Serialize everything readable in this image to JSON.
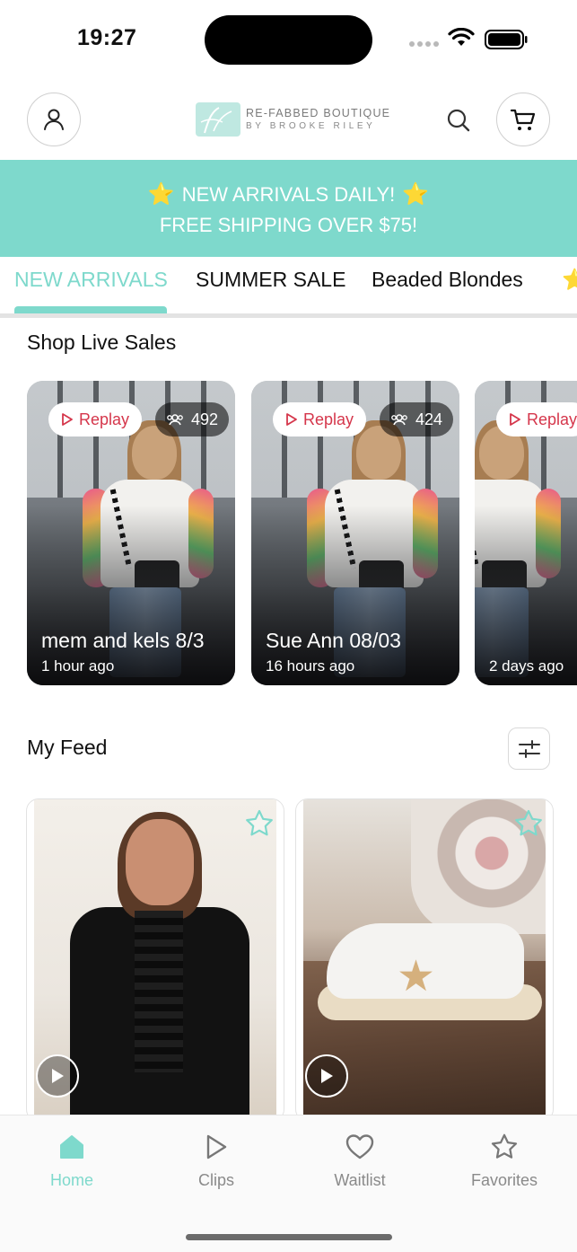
{
  "status_bar": {
    "time": "19:27"
  },
  "header": {
    "logo_line1": "RE-FABBED BOUTIQUE",
    "logo_line2": "BY BROOKE RILEY"
  },
  "banner": {
    "line1": "NEW ARRIVALS DAILY!",
    "line2": "FREE SHIPPING OVER $75!",
    "star_glyph": "⭐"
  },
  "tabs": [
    {
      "label": "NEW ARRIVALS",
      "active": true
    },
    {
      "label": "SUMMER SALE",
      "active": false
    },
    {
      "label": "Beaded Blondes",
      "active": false
    },
    {
      "label": "⭐",
      "active": false
    }
  ],
  "live_sales": {
    "title": "Shop Live Sales",
    "cards": [
      {
        "replay_label": "Replay",
        "viewers": "492",
        "name": "mem and kels 8/3",
        "time": "1 hour ago"
      },
      {
        "replay_label": "Replay",
        "viewers": "424",
        "name": "Sue Ann 08/03",
        "time": "16 hours ago"
      },
      {
        "replay_label": "Replay",
        "viewers": "",
        "name": "",
        "time": "2 days ago"
      }
    ]
  },
  "feed": {
    "title": "My Feed",
    "items": [
      {
        "media": "black-ruffle-blouse",
        "type": "video"
      },
      {
        "media": "star-sneakers",
        "type": "video"
      }
    ]
  },
  "bottom_nav": [
    {
      "label": "Home",
      "icon": "home-icon",
      "active": true
    },
    {
      "label": "Clips",
      "icon": "play-outline-icon",
      "active": false
    },
    {
      "label": "Waitlist",
      "icon": "heart-icon",
      "active": false
    },
    {
      "label": "Favorites",
      "icon": "star-outline-icon",
      "active": false
    }
  ],
  "colors": {
    "accent": "#7ed9cc",
    "replay_red": "#d5364b",
    "star_yellow": "#f6c945"
  }
}
